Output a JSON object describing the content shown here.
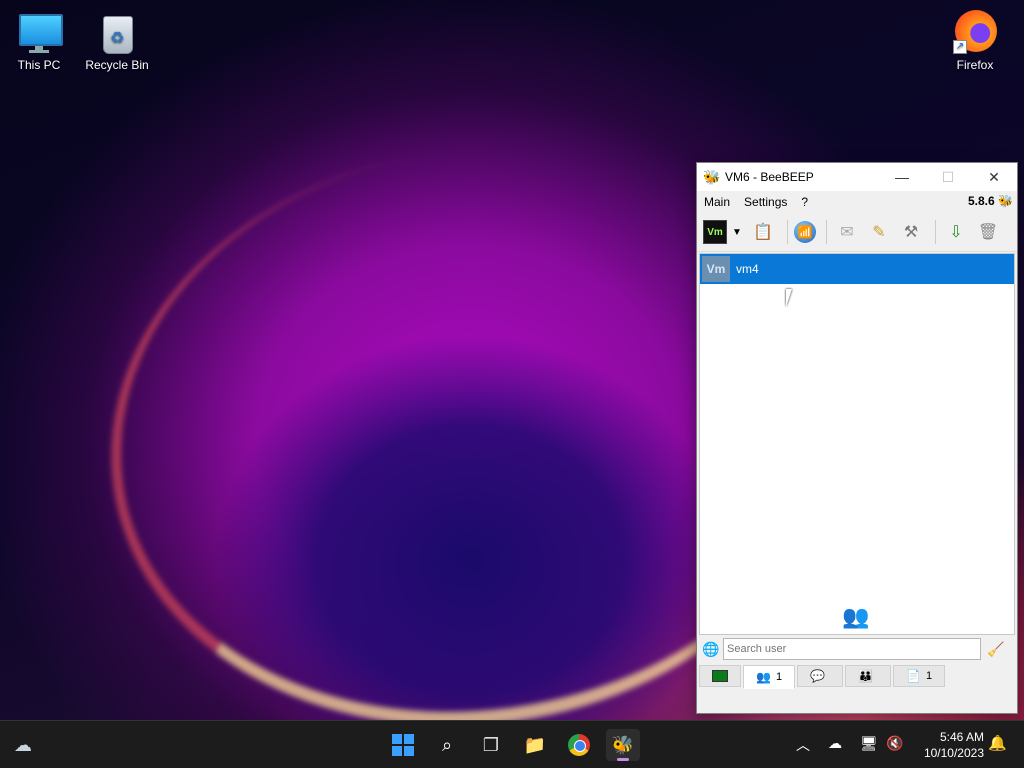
{
  "desktop": {
    "icons": [
      {
        "label": "This PC",
        "icon": "computer-icon"
      },
      {
        "label": "Recycle Bin",
        "icon": "recycle-bin-icon"
      },
      {
        "label": "Firefox",
        "icon": "firefox-icon"
      }
    ]
  },
  "window": {
    "title": "VM6 - BeeBEEP",
    "controls": {
      "minimize": "—",
      "maximize": "☐",
      "close": "✕"
    },
    "menu": [
      "Main",
      "Settings",
      "?"
    ],
    "version": "5.8.6",
    "toolbar": {
      "profile_badge": "Vm",
      "items": [
        "status-dropdown",
        "edit-profile",
        "network",
        "mail",
        "edit",
        "tools",
        "update",
        "clear"
      ]
    },
    "users": [
      {
        "avatar": "Vm",
        "name": "vm4",
        "selected": true
      }
    ],
    "search": {
      "placeholder": "Search user",
      "value": ""
    },
    "tabs": [
      {
        "name": "terminal",
        "count": ""
      },
      {
        "name": "users",
        "count": "1"
      },
      {
        "name": "chats",
        "count": ""
      },
      {
        "name": "groups",
        "count": ""
      },
      {
        "name": "files",
        "count": "1"
      }
    ],
    "colors": {
      "selection": "#0a78d7",
      "accent": "#6a8e2a"
    }
  },
  "taskbar": {
    "apps": [
      "start",
      "search",
      "task-view",
      "file-explorer",
      "chrome",
      "beebeep"
    ],
    "clock": {
      "time": "5:46 AM",
      "date": "10/10/2023"
    }
  }
}
